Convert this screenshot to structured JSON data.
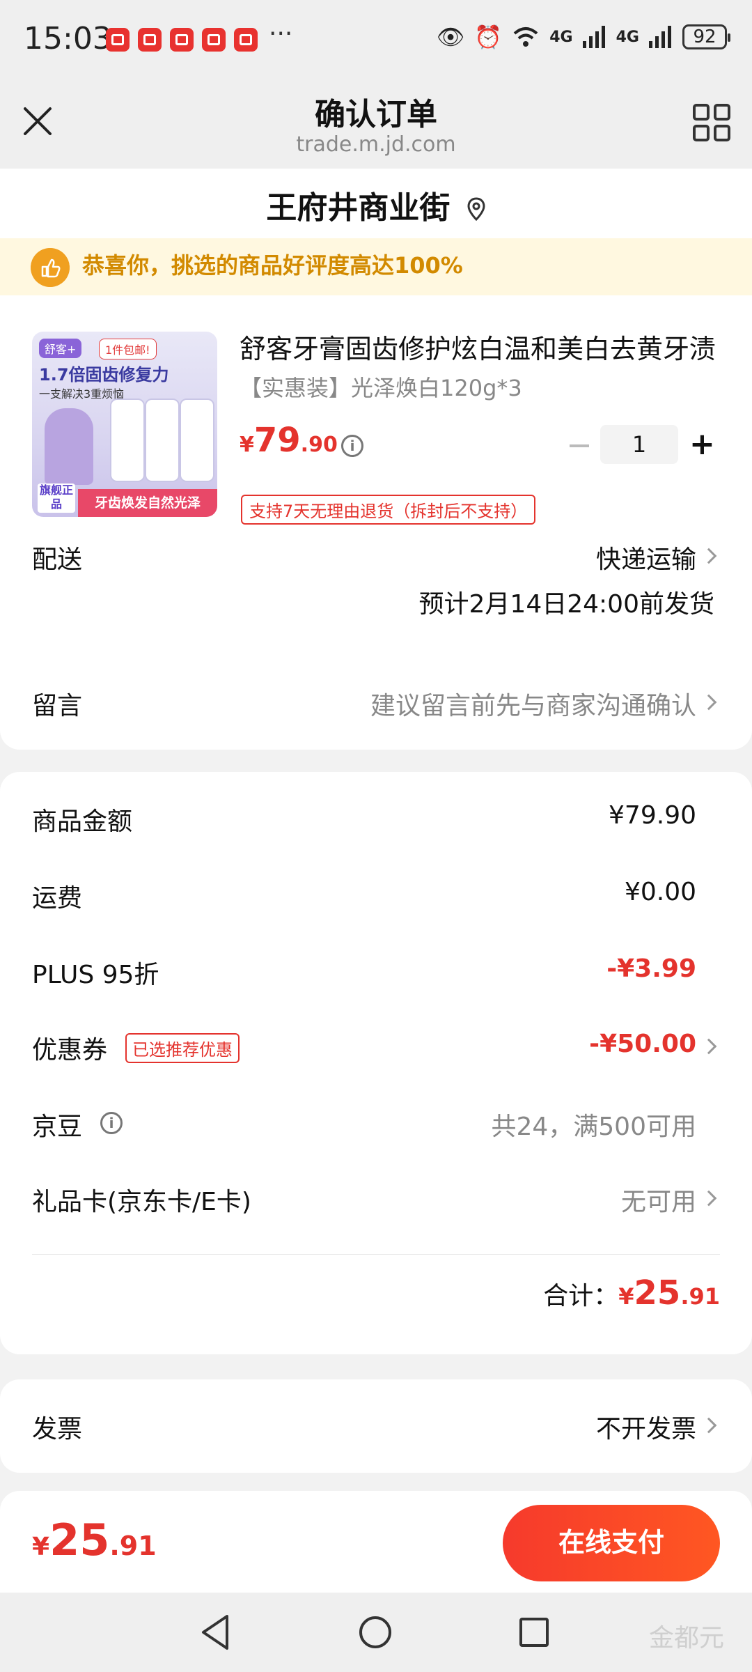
{
  "status_bar": {
    "time": "15:03",
    "more": "···",
    "network1": "4G",
    "network2": "4G",
    "battery": "92"
  },
  "header": {
    "title": "确认订单",
    "url": "trade.m.jd.com"
  },
  "address": {
    "name": "王府井商业街"
  },
  "banner": {
    "text": "恭喜你，挑选的商品好评度高达100%"
  },
  "product": {
    "name": "舒客牙膏固齿修护炫白温和美白去黄牙渍",
    "spec": "【实惠装】光泽焕白120g*3",
    "price_symbol": "¥",
    "price_int": "79",
    "price_dec": ".90",
    "quantity": "1",
    "return_policy": "支持7天无理由退货（拆封后不支持）",
    "image": {
      "tag_brand": "舒客+",
      "tag_ship": "1件包邮!",
      "headline": "1.7倍固齿修复力",
      "subline": "一支解决3重烦恼",
      "badge": "旗舰正品",
      "ribbon": "牙齿焕发自然光泽"
    }
  },
  "delivery": {
    "label": "配送",
    "method": "快递运输",
    "estimate": "预计2月14日24:00前发货"
  },
  "message": {
    "label": "留言",
    "placeholder": "建议留言前先与商家沟通确认"
  },
  "fees": {
    "goods_label": "商品金额",
    "goods_value": "¥79.90",
    "shipping_label": "运费",
    "shipping_value": "¥0.00",
    "plus_label": "PLUS 95折",
    "plus_value": "-¥3.99",
    "coupon_label": "优惠券",
    "coupon_tag": "已选推荐优惠",
    "coupon_value": "-¥50.00",
    "beans_label": "京豆",
    "beans_value": "共24，满500可用",
    "giftcard_label": "礼品卡(京东卡/E卡)",
    "giftcard_value": "无可用",
    "total_label": "合计：",
    "total_symbol": "¥",
    "total_int": "25",
    "total_dec": ".91"
  },
  "invoice": {
    "label": "发票",
    "value": "不开发票"
  },
  "pay": {
    "symbol": "¥",
    "int": "25",
    "dec": ".91",
    "button": "在线支付"
  },
  "watermark": "金都元",
  "colors": {
    "accent_red": "#e4332d",
    "banner_text": "#d28a00",
    "banner_bg": "#fff8e0"
  }
}
